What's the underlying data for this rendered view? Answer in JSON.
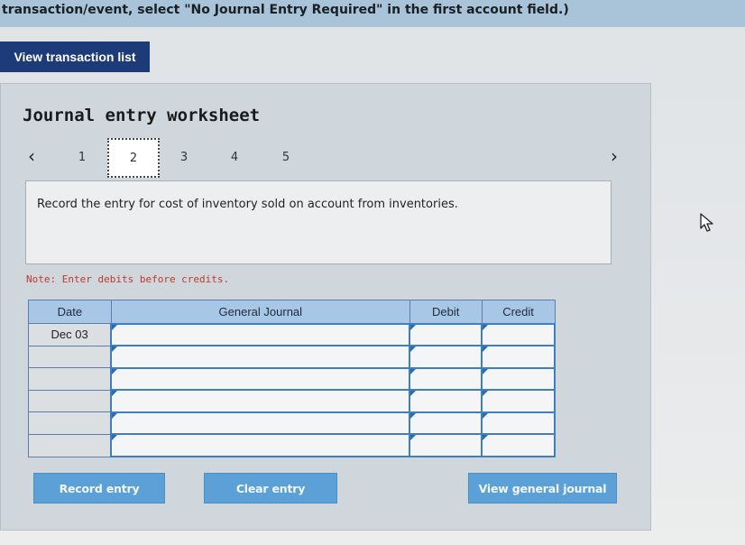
{
  "header": {
    "instruction_text": "transaction/event, select \"No Journal Entry Required\" in the first account field.)"
  },
  "toolbar": {
    "view_transaction_list_label": "View transaction list"
  },
  "worksheet": {
    "title": "Journal entry worksheet",
    "prev_icon": "chevron-left-icon",
    "next_icon": "chevron-right-icon",
    "steps": [
      "1",
      "2",
      "3",
      "4",
      "5"
    ],
    "active_step": "2",
    "instruction": "Record the entry for cost of inventory sold on account from inventories.",
    "note": "Note: Enter debits before credits."
  },
  "journal": {
    "columns": [
      "Date",
      "General Journal",
      "Debit",
      "Credit"
    ],
    "rows": [
      {
        "date": "Dec 03",
        "account": "",
        "debit": "",
        "credit": ""
      },
      {
        "date": "",
        "account": "",
        "debit": "",
        "credit": ""
      },
      {
        "date": "",
        "account": "",
        "debit": "",
        "credit": ""
      },
      {
        "date": "",
        "account": "",
        "debit": "",
        "credit": ""
      },
      {
        "date": "",
        "account": "",
        "debit": "",
        "credit": ""
      },
      {
        "date": "",
        "account": "",
        "debit": "",
        "credit": ""
      }
    ]
  },
  "actions": {
    "record_label": "Record entry",
    "clear_label": "Clear entry",
    "view_journal_label": "View general journal"
  },
  "cursor_icon": "mouse-pointer-icon",
  "colors": {
    "primary_dark": "#1d3b78",
    "action_blue": "#5ba0d6",
    "header_blue": "#a8c6e6",
    "note_red": "#c0392b"
  }
}
